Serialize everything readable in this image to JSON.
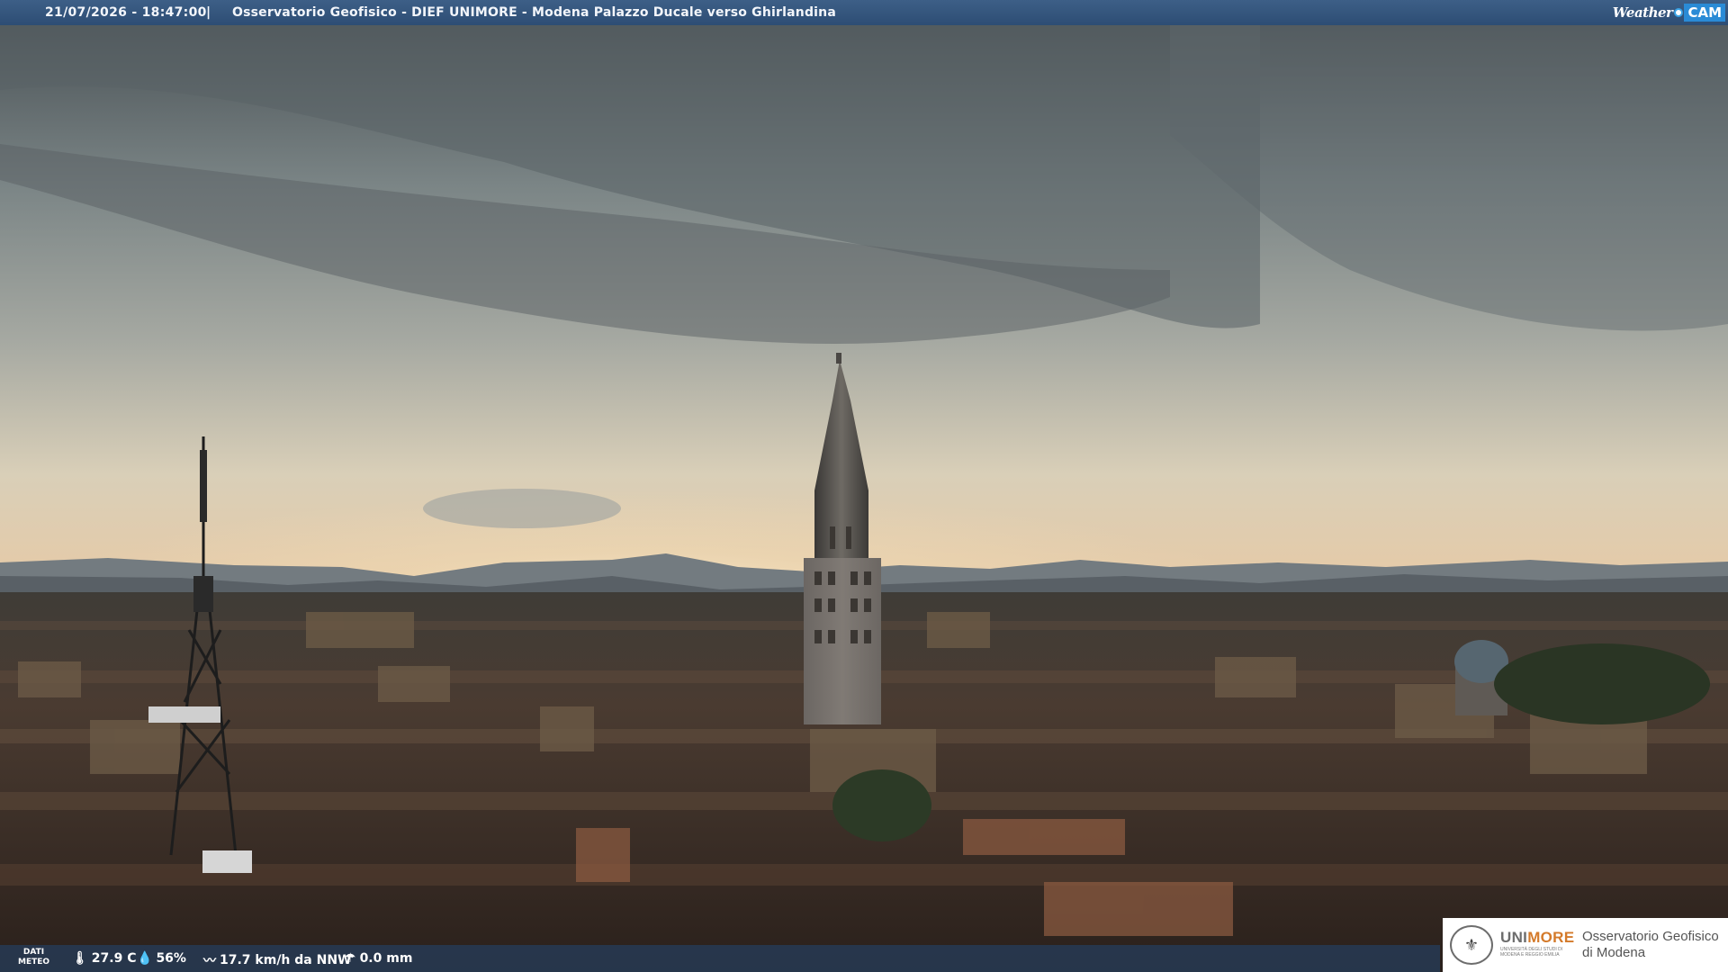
{
  "header": {
    "timestamp": "21/07/2026 - 18:47:00",
    "separator": "|",
    "camera_title": "Osservatorio Geofisico - DIEF UNIMORE - Modena Palazzo Ducale verso Ghirlandina",
    "brand_left": "Weather",
    "brand_right": "CAM"
  },
  "weather": {
    "label_line1": "DATI",
    "label_line2": "METEO",
    "temperature": "27.9 C",
    "humidity": "56%",
    "wind": "17.7 km/h da NNW",
    "rain": "0.0 mm",
    "icons": [
      "thermometer-icon",
      "humidity-drop-icon",
      "wind-icon",
      "rain-gauge-icon"
    ]
  },
  "logo": {
    "uni_prefix": "UNI",
    "uni_suffix": "MORE",
    "uni_subtitle": "UNIVERSITÀ DEGLI STUDI DI MODENA E REGGIO EMILIA",
    "observatory_line1": "Osservatorio Geofisico",
    "observatory_line2": "di Modena"
  },
  "colors": {
    "topbar": "#2d4d74",
    "brand_accent": "#2a8bd6",
    "unimore_accent": "#d47a2a"
  }
}
